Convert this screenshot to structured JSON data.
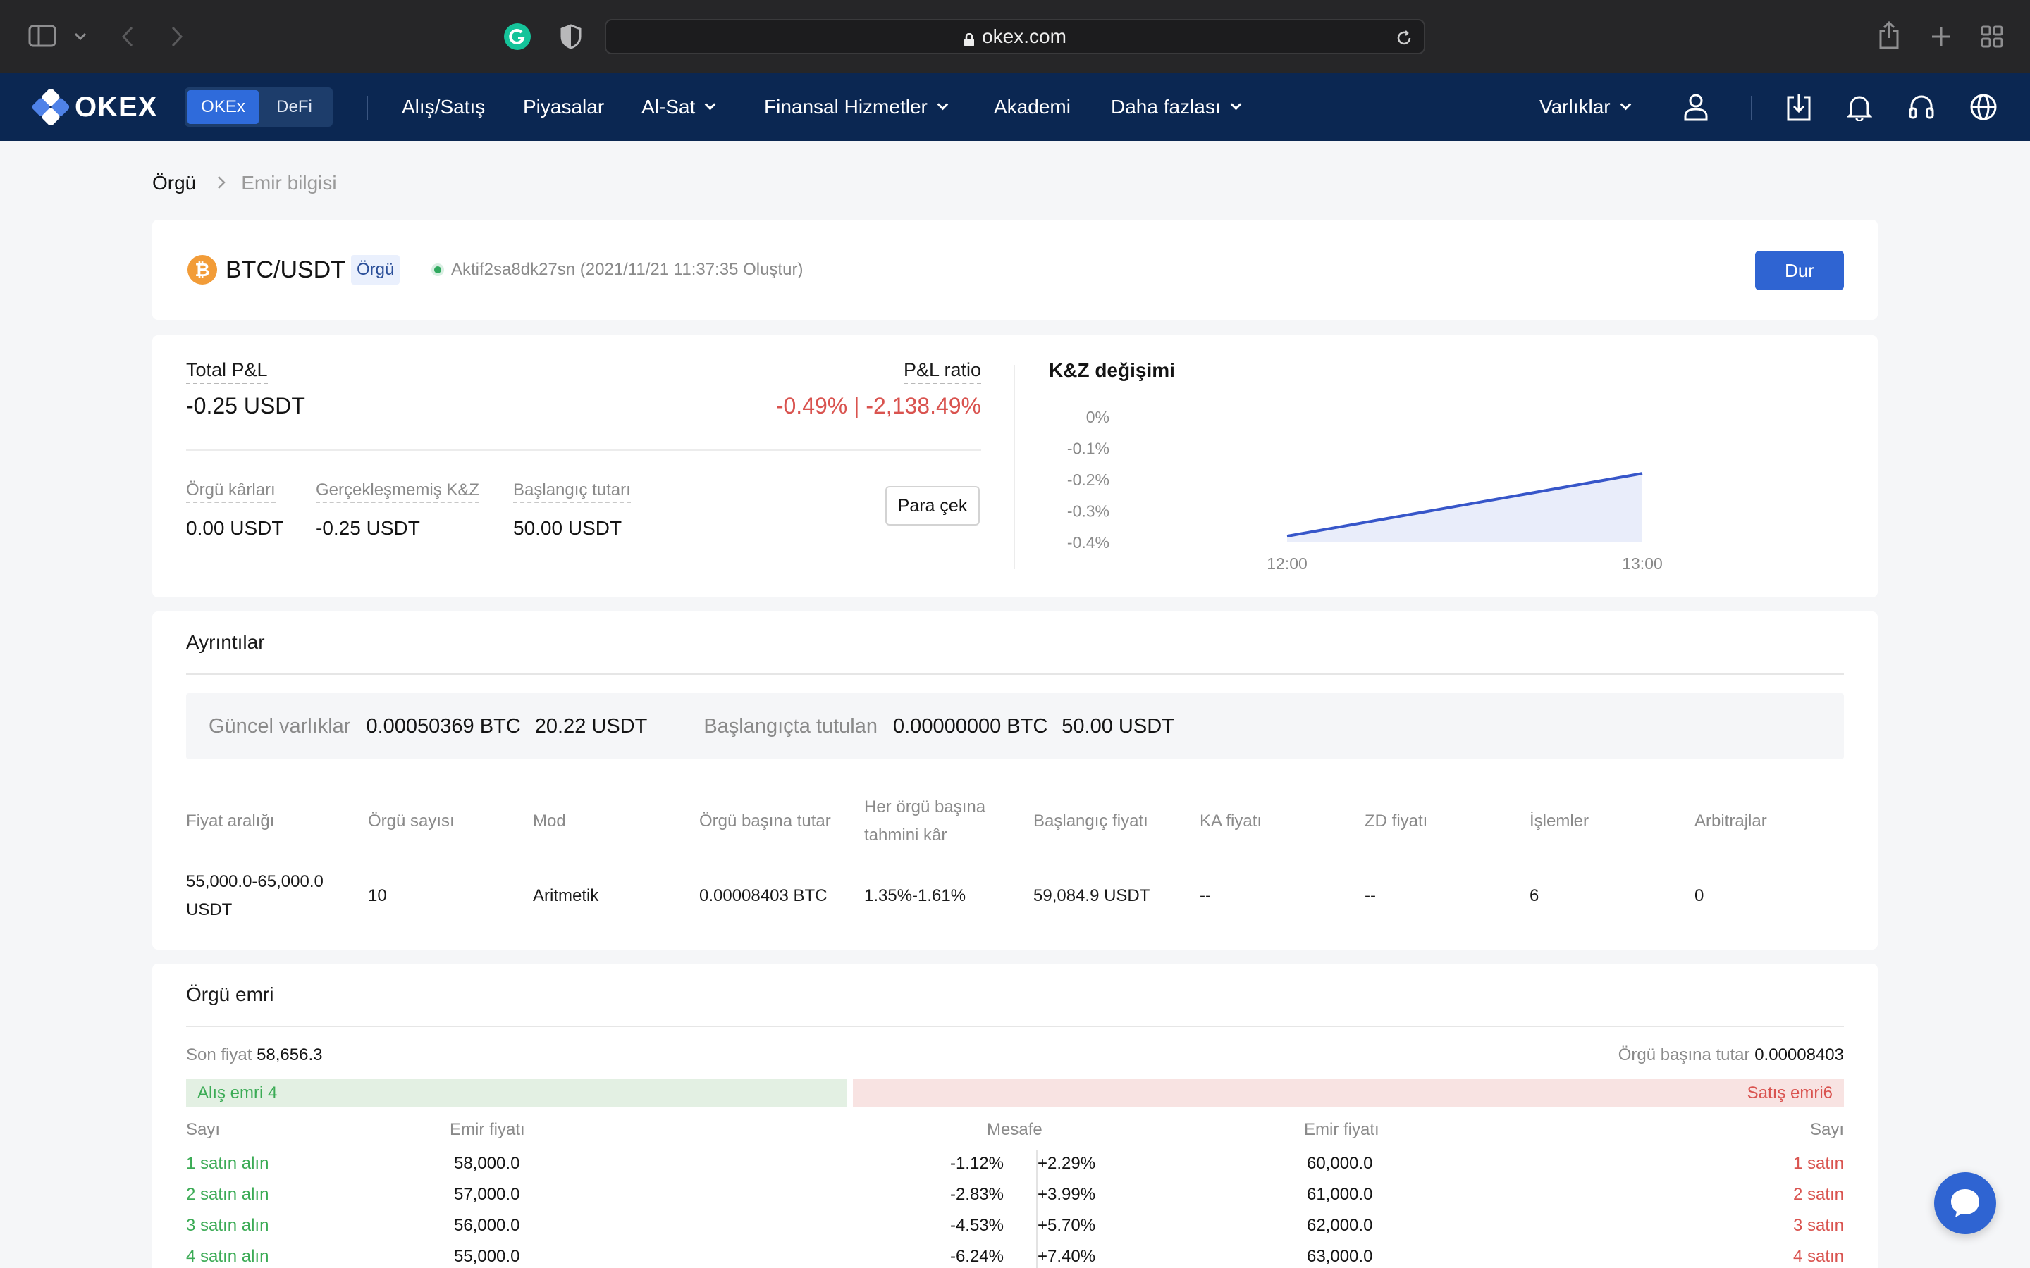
{
  "browser": {
    "url": "okex.com"
  },
  "nav": {
    "logo": "OKEX",
    "seg": [
      "OKEx",
      "DeFi"
    ],
    "items": [
      "Alış/Satış",
      "Piyasalar",
      "Al-Sat",
      "Finansal Hizmetler",
      "Akademi",
      "Daha fazlası"
    ],
    "assets": "Varlıklar"
  },
  "breadcrumb": {
    "parent": "Örgü",
    "current": "Emir bilgisi"
  },
  "header": {
    "coin_symbol": "₿",
    "pair": "BTC/USDT",
    "tag": "Örgü",
    "status": "Aktif2sa8dk27sn (2021/11/21 11:37:35 Oluştur)",
    "stop_button": "Dur"
  },
  "pnl": {
    "total_label": "Total P&L",
    "total_value": "-0.25 USDT",
    "ratio_label": "P&L ratio",
    "ratio_value": "-0.49% | -2,138.49%",
    "grid_profit_label": "Örgü kârları",
    "grid_profit_value": "0.00 USDT",
    "unrealized_label": "Gerçekleşmemiş K&Z",
    "unrealized_value": "-0.25 USDT",
    "initial_label": "Başlangıç tutarı",
    "initial_value": "50.00 USDT",
    "withdraw_button": "Para çek"
  },
  "chart_data": {
    "type": "area",
    "title": "K&Z değişimi",
    "x": [
      "12:00",
      "13:00"
    ],
    "x_ticks": [
      "12:00",
      "13:00"
    ],
    "y_ticks": [
      "0%",
      "-0.1%",
      "-0.2%",
      "-0.3%",
      "-0.4%"
    ],
    "ylim": [
      -0.4,
      0
    ],
    "series": [
      {
        "values": [
          -0.38,
          -0.18
        ]
      }
    ],
    "colors": {
      "line": "#3756c9",
      "fill": "#e9edfa"
    }
  },
  "details": {
    "title": "Ayrıntılar",
    "current_label": "Güncel varlıklar",
    "current_btc": "0.00050369 BTC",
    "current_usdt": "20.22 USDT",
    "initial_label": "Başlangıçta tutulan",
    "initial_btc": "0.00000000 BTC",
    "initial_usdt": "50.00 USDT",
    "headers": [
      "Fiyat aralığı",
      "Örgü sayısı",
      "Mod",
      "Örgü başına tutar",
      "Her örgü başına",
      "tahmini kâr",
      "Başlangıç fiyatı",
      "KA fiyatı",
      "ZD fiyatı",
      "İşlemler",
      "Arbitrajlar"
    ],
    "row": {
      "range1": "55,000.0-65,000.0",
      "range2": "USDT",
      "grids": "10",
      "mode": "Aritmetik",
      "per_grid": "0.00008403 BTC",
      "profit": "1.35%-1.61%",
      "start_price": "59,084.9 USDT",
      "tp": "--",
      "sl": "--",
      "trades": "6",
      "arb": "0"
    }
  },
  "grid_orders": {
    "title": "Örgü emri",
    "last_price_label": "Son fiyat",
    "last_price": "58,656.3",
    "per_grid_label": "Örgü başına tutar",
    "per_grid_value": "0.00008403",
    "buy_bar": "Alış emri 4",
    "sell_bar": "Satış emri6",
    "headers": {
      "qty": "Sayı",
      "price": "Emir fiyatı",
      "distance": "Mesafe"
    },
    "rows": [
      {
        "buy": "1 satın alın",
        "buy_price": "58,000.0",
        "buy_dist": "-1.12%",
        "sell_dist": "+2.29%",
        "sell_price": "60,000.0",
        "sell": "1 satın"
      },
      {
        "buy": "2 satın alın",
        "buy_price": "57,000.0",
        "buy_dist": "-2.83%",
        "sell_dist": "+3.99%",
        "sell_price": "61,000.0",
        "sell": "2 satın"
      },
      {
        "buy": "3 satın alın",
        "buy_price": "56,000.0",
        "buy_dist": "-4.53%",
        "sell_dist": "+5.70%",
        "sell_price": "62,000.0",
        "sell": "3 satın"
      },
      {
        "buy": "4 satın alın",
        "buy_price": "55,000.0",
        "buy_dist": "-6.24%",
        "sell_dist": "+7.40%",
        "sell_price": "63,000.0",
        "sell": "4 satın"
      }
    ]
  }
}
